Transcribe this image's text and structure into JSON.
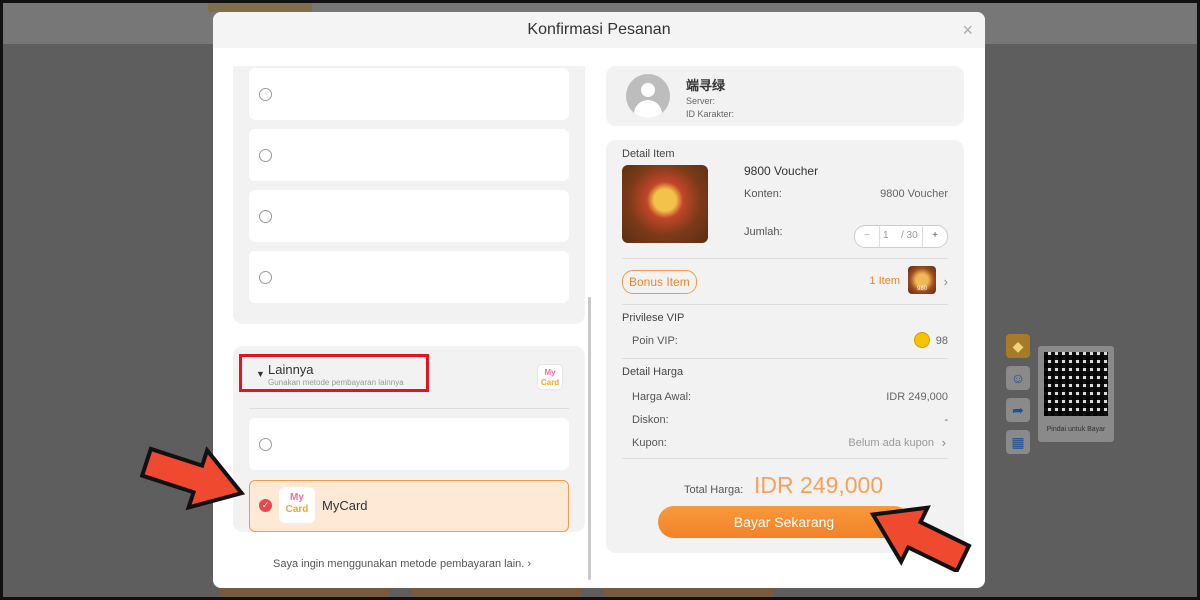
{
  "modal": {
    "title": "Konfirmasi Pesanan",
    "close_label": "×"
  },
  "payment": {
    "other_title": "Lainnya",
    "other_subtitle": "Gunakan metode pembayaran lainnya",
    "mycard_label": "MyCard",
    "mycard_logo_line1": "My",
    "mycard_logo_line2": "Card",
    "other_method_link": "Saya ingin menggunakan metode pembayaran lain.",
    "selected": "MyCard"
  },
  "user": {
    "name": "端寻绿",
    "server_label": "Server:",
    "id_label": "ID Karakter:"
  },
  "item": {
    "section_label": "Detail Item",
    "name": "9800 Voucher",
    "content_label": "Konten:",
    "content_value": "9800 Voucher",
    "quantity_label": "Jumlah:",
    "quantity": "1",
    "quantity_max": "/ 30",
    "minus": "−",
    "plus": "+"
  },
  "bonus": {
    "label": "Bonus Item",
    "count": "1 Item",
    "thumb_text": "980"
  },
  "vip": {
    "section_label": "Privilese VIP",
    "points_label": "Poin VIP:",
    "points_value": "98"
  },
  "price": {
    "section_label": "Detail Harga",
    "original_label": "Harga Awal:",
    "original_value": "IDR 249,000",
    "discount_label": "Diskon:",
    "discount_value": "-",
    "coupon_label": "Kupon:",
    "coupon_value": "Belum ada kupon",
    "total_label": "Total Harga:",
    "total_value": "IDR 249,000",
    "pay_button": "Bayar Sekarang"
  },
  "qr": {
    "caption": "Pindai untuk Bayar"
  },
  "colors": {
    "accent": "#f2822a",
    "highlight_box": "#e3141d",
    "arrow": "#ef4a2f"
  }
}
